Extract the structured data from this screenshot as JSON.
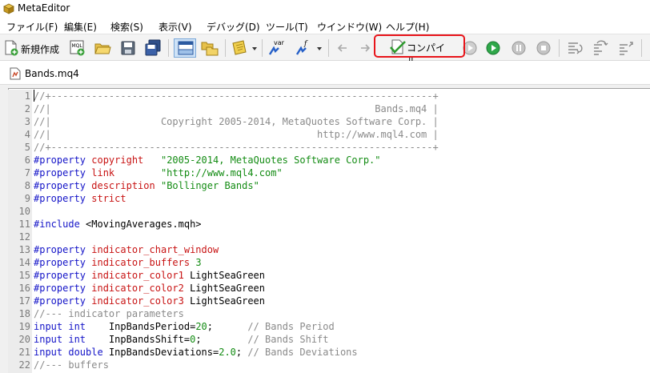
{
  "window": {
    "title": "MetaEditor"
  },
  "menu": [
    "ファイル(F)",
    "編集(E)",
    "検索(S)",
    "表示(V)",
    "デバッグ(D)",
    "ツール(T)",
    "ウインドウ(W)",
    "ヘルプ(H)"
  ],
  "toolbar": {
    "new_label": "新規作成",
    "compile_label": "コンパイル",
    "mql_icon_text": "MQL",
    "var_icon_text": "var",
    "func_icon_text": "f"
  },
  "tab": {
    "label": "Bands.mq4"
  },
  "colors": {
    "highlight": "#e8141a",
    "comment": "#8a8a8a",
    "keyword": "#1414c8",
    "property": "#c81414",
    "string": "#148c14"
  },
  "code": [
    {
      "n": "1",
      "parts": [
        {
          "t": "//+------------------------------------------------------------------+",
          "c": "comment"
        }
      ]
    },
    {
      "n": "2",
      "parts": [
        {
          "t": "//|                                                        Bands.mq4 |",
          "c": "comment"
        }
      ]
    },
    {
      "n": "3",
      "parts": [
        {
          "t": "//|                   Copyright 2005-2014, MetaQuotes Software Corp. |",
          "c": "comment"
        }
      ]
    },
    {
      "n": "4",
      "parts": [
        {
          "t": "//|                                              http://www.mql4.com |",
          "c": "comment"
        }
      ]
    },
    {
      "n": "5",
      "parts": [
        {
          "t": "//+------------------------------------------------------------------+",
          "c": "comment"
        }
      ]
    },
    {
      "n": "6",
      "parts": [
        {
          "t": "#property ",
          "c": "kw"
        },
        {
          "t": "copyright",
          "c": "prop"
        },
        {
          "t": "   ",
          "c": ""
        },
        {
          "t": "\"2005-2014, MetaQuotes Software Corp.\"",
          "c": "str"
        }
      ]
    },
    {
      "n": "7",
      "parts": [
        {
          "t": "#property ",
          "c": "kw"
        },
        {
          "t": "link",
          "c": "prop"
        },
        {
          "t": "        ",
          "c": ""
        },
        {
          "t": "\"http://www.mql4.com\"",
          "c": "str"
        }
      ]
    },
    {
      "n": "8",
      "parts": [
        {
          "t": "#property ",
          "c": "kw"
        },
        {
          "t": "description",
          "c": "prop"
        },
        {
          "t": " ",
          "c": ""
        },
        {
          "t": "\"Bollinger Bands\"",
          "c": "str"
        }
      ]
    },
    {
      "n": "9",
      "parts": [
        {
          "t": "#property ",
          "c": "kw"
        },
        {
          "t": "strict",
          "c": "prop"
        }
      ]
    },
    {
      "n": "10",
      "parts": []
    },
    {
      "n": "11",
      "parts": [
        {
          "t": "#include ",
          "c": "kw"
        },
        {
          "t": "<MovingAverages.mqh>",
          "c": ""
        }
      ]
    },
    {
      "n": "12",
      "parts": []
    },
    {
      "n": "13",
      "parts": [
        {
          "t": "#property ",
          "c": "kw"
        },
        {
          "t": "indicator_chart_window",
          "c": "prop"
        }
      ]
    },
    {
      "n": "14",
      "parts": [
        {
          "t": "#property ",
          "c": "kw"
        },
        {
          "t": "indicator_buffers",
          "c": "prop"
        },
        {
          "t": " ",
          "c": ""
        },
        {
          "t": "3",
          "c": "num"
        }
      ]
    },
    {
      "n": "15",
      "parts": [
        {
          "t": "#property ",
          "c": "kw"
        },
        {
          "t": "indicator_color1",
          "c": "prop"
        },
        {
          "t": " LightSeaGreen",
          "c": ""
        }
      ]
    },
    {
      "n": "16",
      "parts": [
        {
          "t": "#property ",
          "c": "kw"
        },
        {
          "t": "indicator_color2",
          "c": "prop"
        },
        {
          "t": " LightSeaGreen",
          "c": ""
        }
      ]
    },
    {
      "n": "17",
      "parts": [
        {
          "t": "#property ",
          "c": "kw"
        },
        {
          "t": "indicator_color3",
          "c": "prop"
        },
        {
          "t": " LightSeaGreen",
          "c": ""
        }
      ]
    },
    {
      "n": "18",
      "parts": [
        {
          "t": "//--- indicator parameters",
          "c": "comment"
        }
      ]
    },
    {
      "n": "19",
      "parts": [
        {
          "t": "input ",
          "c": "type"
        },
        {
          "t": "int",
          "c": "type"
        },
        {
          "t": "    InpBandsPeriod=",
          "c": ""
        },
        {
          "t": "20",
          "c": "num"
        },
        {
          "t": ";      ",
          "c": ""
        },
        {
          "t": "// Bands Period",
          "c": "comment"
        }
      ]
    },
    {
      "n": "20",
      "parts": [
        {
          "t": "input ",
          "c": "type"
        },
        {
          "t": "int",
          "c": "type"
        },
        {
          "t": "    InpBandsShift=",
          "c": ""
        },
        {
          "t": "0",
          "c": "num"
        },
        {
          "t": ";        ",
          "c": ""
        },
        {
          "t": "// Bands Shift",
          "c": "comment"
        }
      ]
    },
    {
      "n": "21",
      "parts": [
        {
          "t": "input ",
          "c": "type"
        },
        {
          "t": "double",
          "c": "type"
        },
        {
          "t": " InpBandsDeviations=",
          "c": ""
        },
        {
          "t": "2.0",
          "c": "num"
        },
        {
          "t": "; ",
          "c": ""
        },
        {
          "t": "// Bands Deviations",
          "c": "comment"
        }
      ]
    },
    {
      "n": "22",
      "parts": [
        {
          "t": "//--- buffers",
          "c": "comment"
        }
      ]
    }
  ]
}
